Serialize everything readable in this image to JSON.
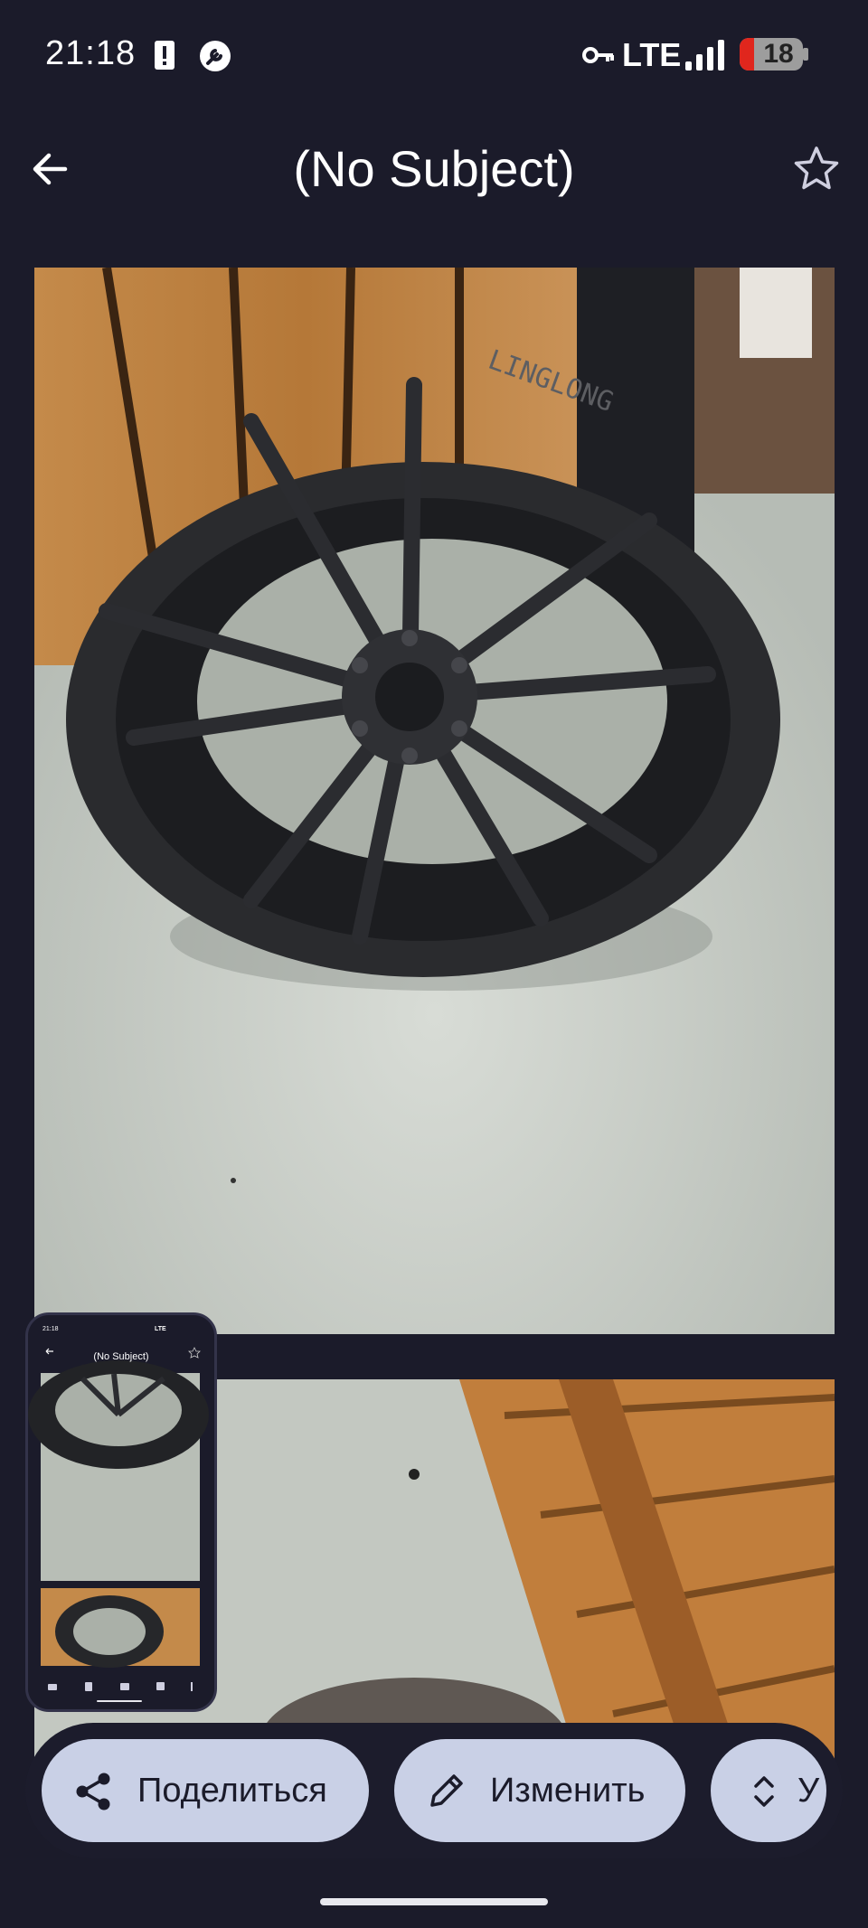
{
  "status_bar": {
    "time": "21:18",
    "network": "LTE",
    "battery_level": "18",
    "icons": [
      "alert-icon",
      "wrench-icon",
      "vpn-key-icon",
      "signal-icon",
      "battery-icon"
    ]
  },
  "app_bar": {
    "title": "(No Subject)",
    "back_icon": "arrow-back-icon",
    "star_icon": "star-outline-icon"
  },
  "thumbnail": {
    "time": "21:18",
    "network": "LTE",
    "title": "(No Subject)"
  },
  "actions": {
    "share_label": "Поделиться",
    "edit_label": "Изменить",
    "more_label": "У",
    "share_icon": "share-icon",
    "edit_icon": "pencil-icon",
    "more_icon": "expand-icon"
  },
  "colors": {
    "background": "#1b1b2a",
    "pill": "#c9d0e6",
    "battery_low": "#e0261d"
  }
}
